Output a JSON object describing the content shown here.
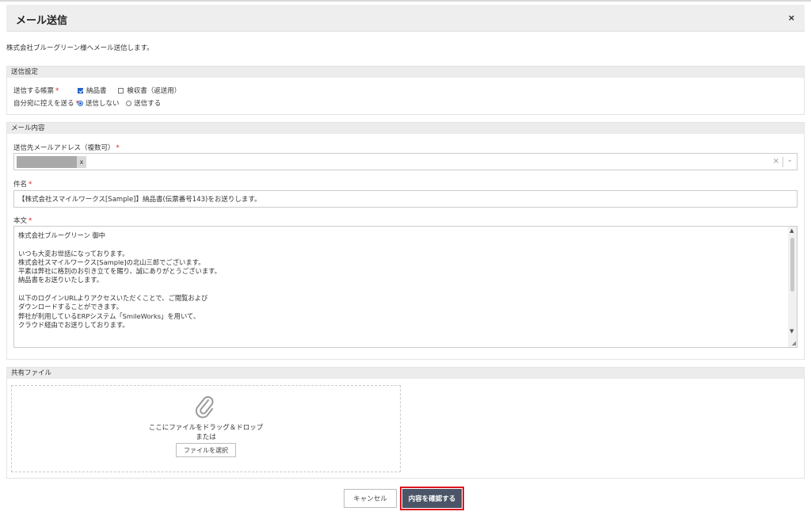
{
  "dialog": {
    "title": "メール送信",
    "close_label": "×",
    "intro": "株式会社ブルーグリーン様へメール送信します。"
  },
  "send_settings": {
    "heading": "送信設定",
    "forms_label": "送信する帳票",
    "required_mark": "*",
    "form_options": [
      {
        "label": "納品書",
        "checked": true
      },
      {
        "label": "検収書（返送用）",
        "checked": false
      }
    ],
    "cc_self_label": "自分宛に控えを送る",
    "cc_options": [
      {
        "label": "送信しない",
        "selected": true
      },
      {
        "label": "送信する",
        "selected": false
      }
    ]
  },
  "mail_content": {
    "heading": "メール内容",
    "to_label": "送信先メールアドレス（複数可）",
    "required_mark": "*",
    "chip_remove": "x",
    "clear_icon": "×",
    "chevron": "⌄",
    "subject_label": "件名",
    "subject_value": "【株式会社スマイルワークス[Sample]】納品書(伝票番号143)をお送りします。",
    "body_label": "本文",
    "body_lines": [
      "株式会社ブルーグリーン 御中",
      "",
      "いつも大変お世話になっております。",
      "株式会社スマイルワークス[Sample]の北山三郎でございます。",
      "平素は弊社に格別のお引き立てを賜り、誠にありがとうございます。",
      "納品書をお送りいたします。",
      "",
      "以下のログインURLよりアクセスいただくことで、ご閲覧および",
      "ダウンロードすることができます。",
      "弊社が利用しているERPシステム「SmileWorks」を用いて、",
      "クラウド経由でお送りしております。"
    ]
  },
  "shared_files": {
    "heading": "共有ファイル",
    "drop_text": "ここにファイルをドラッグ＆ドロップ",
    "or_text": "または",
    "select_button": "ファイルを選択",
    "icon": "paperclip-icon"
  },
  "footer": {
    "cancel_label": "キャンセル",
    "confirm_label": "内容を確認する"
  },
  "colors": {
    "confirm_bg": "#4c5567",
    "highlight": "#e0141e",
    "accent": "#2463c7",
    "required": "#dd2222"
  }
}
